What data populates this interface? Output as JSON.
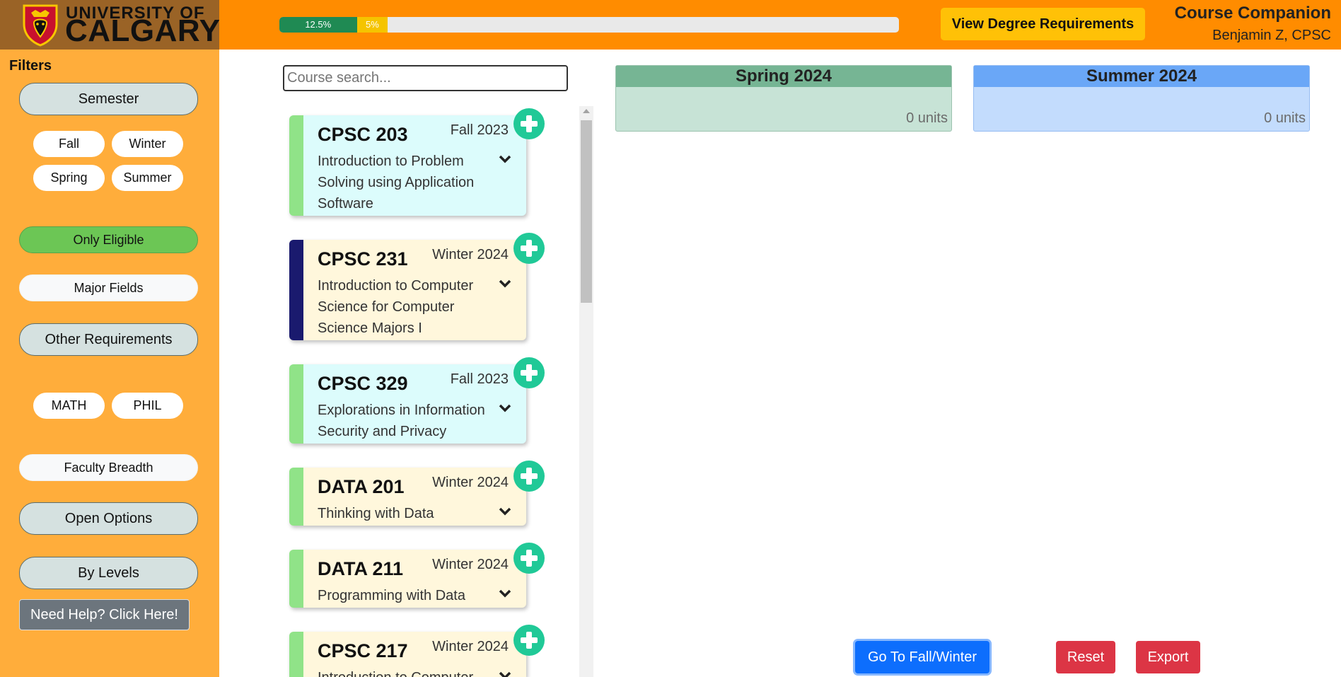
{
  "header": {
    "logo_line1": "UNIVERSITY OF",
    "logo_line2": "CALGARY",
    "progress": [
      {
        "label": "12.5%",
        "value": 12.5,
        "color": "#1f8a53"
      },
      {
        "label": "5%",
        "value": 5,
        "color": "#f5c400"
      }
    ],
    "degree_button": "View Degree Requirements",
    "app_title": "Course Companion",
    "user": "Benjamin Z, CPSC"
  },
  "sidebar": {
    "filters_label": "Filters",
    "semester_button": "Semester",
    "semester_options": [
      "Fall",
      "Winter",
      "Spring",
      "Summer"
    ],
    "only_eligible": "Only Eligible",
    "major_fields": "Major Fields",
    "other_requirements": "Other Requirements",
    "other_options": [
      "MATH",
      "PHIL"
    ],
    "faculty_breadth": "Faculty Breadth",
    "open_options": "Open Options",
    "by_levels": "By Levels",
    "help_button": "Need Help? Click Here!"
  },
  "search": {
    "placeholder": "Course search..."
  },
  "courses": [
    {
      "code": "CPSC 203",
      "semester": "Fall 2023",
      "title": "Introduction to Problem Solving using Application Software",
      "stripe": "#90e388",
      "bg": "#dcfcfc"
    },
    {
      "code": "CPSC 231",
      "semester": "Winter 2024",
      "title": "Introduction to Computer Science for Computer Science Majors I",
      "stripe": "#1a1a6e",
      "bg": "#fff7dc"
    },
    {
      "code": "CPSC 329",
      "semester": "Fall 2023",
      "title": "Explorations in Information Security and Privacy",
      "stripe": "#90e388",
      "bg": "#dcfcfc"
    },
    {
      "code": "DATA 201",
      "semester": "Winter 2024",
      "title": "Thinking with Data",
      "stripe": "#90e388",
      "bg": "#fff7dc"
    },
    {
      "code": "DATA 211",
      "semester": "Winter 2024",
      "title": "Programming with Data",
      "stripe": "#90e388",
      "bg": "#fff7dc"
    },
    {
      "code": "CPSC 217",
      "semester": "Winter 2024",
      "title": "Introduction to Computer",
      "stripe": "#90e388",
      "bg": "#fff7dc"
    }
  ],
  "semesters": [
    {
      "name": "Spring 2024",
      "units": "0 units"
    },
    {
      "name": "Summer 2024",
      "units": "0 units"
    }
  ],
  "actions": {
    "goto": "Go To Fall/Winter",
    "reset": "Reset",
    "export": "Export"
  }
}
